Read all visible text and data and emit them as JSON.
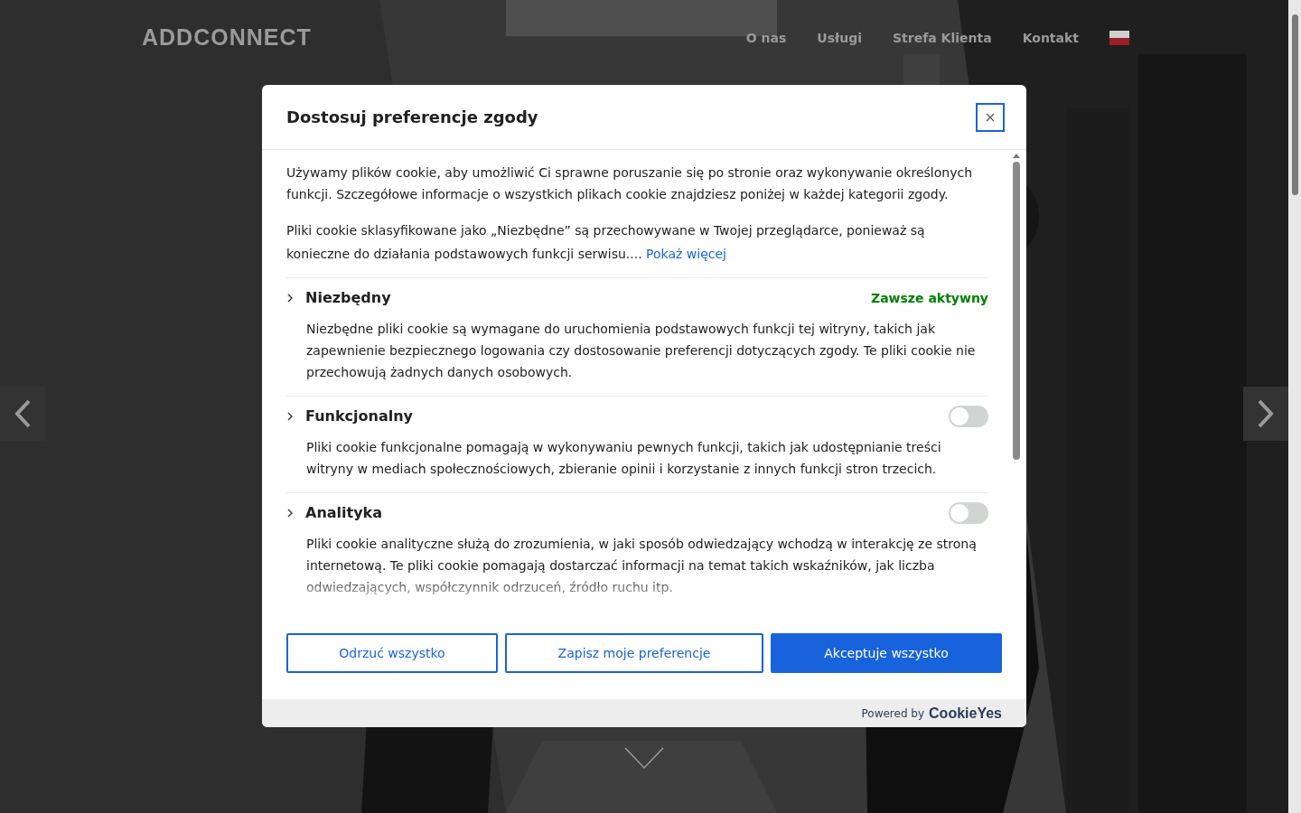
{
  "site": {
    "logo": "ADDCONNECT",
    "nav": [
      {
        "label": "O nas"
      },
      {
        "label": "Usługi"
      },
      {
        "label": "Strefa Klienta"
      },
      {
        "label": "Kontakt"
      }
    ]
  },
  "dialog": {
    "title": "Dostosuj preferencje zgody",
    "intro": [
      "Używamy plików cookie, aby umożliwić Ci sprawne poruszanie się po stronie oraz wykonywanie określonych funkcji. Szczegółowe informacje o wszystkich plikach cookie znajdziesz poniżej w każdej kategorii zgody.",
      "Pliki cookie sklasyfikowane jako „Niezbędne” są przechowywane w Twojej przeglądarce, ponieważ są konieczne do działania podstawowych funkcji serwisu...."
    ],
    "show_more": "Pokaż więcej",
    "categories": [
      {
        "kind": "always",
        "name": "Niezbędny",
        "status": "Zawsze aktywny",
        "description": "Niezbędne pliki cookie są wymagane do uruchomienia podstawowych funkcji tej witryny, takich jak zapewnienie bezpiecznego logowania czy dostosowanie preferencji dotyczących zgody. Te pliki cookie nie przechowują żadnych danych osobowych."
      },
      {
        "kind": "toggle",
        "name": "Funkcjonalny",
        "on": false,
        "description": "Pliki cookie funkcjonalne pomagają w wykonywaniu pewnych funkcji, takich jak udostępnianie treści witryny w mediach społecznościowych, zbieranie opinii i korzystanie z innych funkcji stron trzecich."
      },
      {
        "kind": "toggle",
        "name": "Analityka",
        "on": false,
        "description": "Pliki cookie analityczne służą do zrozumienia, w jaki sposób odwiedzający wchodzą w interakcję ze stroną internetową. Te pliki cookie pomagają dostarczać informacji na temat takich wskaźników, jak liczba odwiedzających, współczynnik odrzuceń, źródło ruchu itp."
      }
    ],
    "buttons": [
      {
        "kind": "outline",
        "label": "Odrzuć wszystko"
      },
      {
        "kind": "outline",
        "label": "Zapisz moje preferencje"
      },
      {
        "kind": "primary",
        "label": "Akceptuje wszystko"
      }
    ],
    "footer": {
      "powered_by": "Powered by",
      "brand": "CookieYes"
    }
  }
}
